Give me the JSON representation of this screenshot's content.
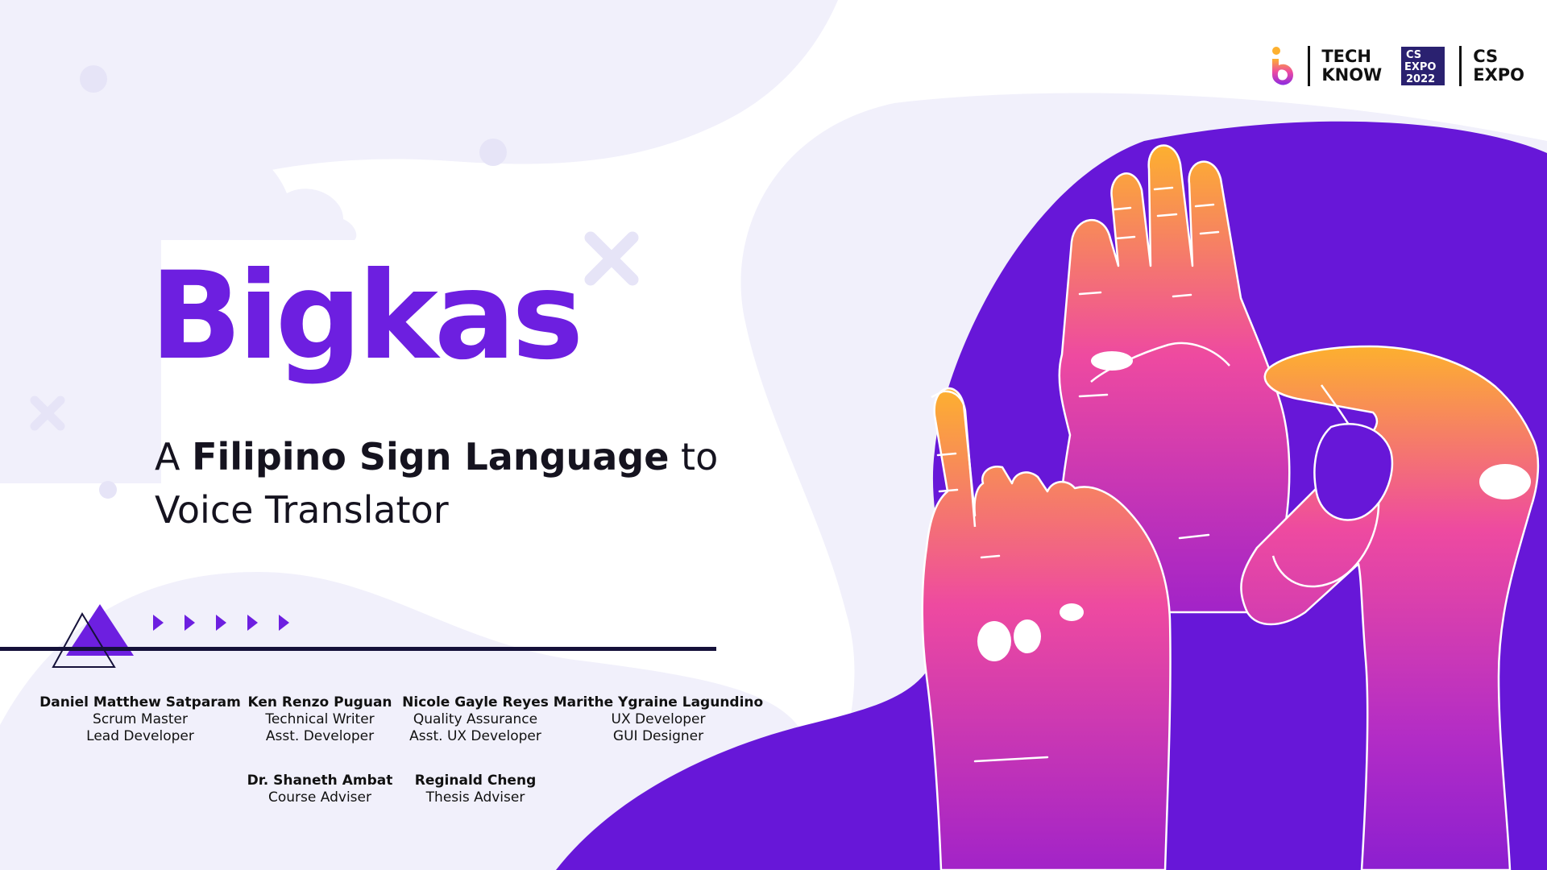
{
  "title": "Bigkas",
  "subtitle": {
    "prefix": "A ",
    "highlight": "Filipino Sign Language",
    "suffix": " to",
    "line2": "Voice Translator"
  },
  "logos": {
    "techknow_line1": "TECH",
    "techknow_line2": "KNOW",
    "expo_badge_line1": "CS",
    "expo_badge_line2": "EXPO",
    "expo_badge_line3": "2022",
    "csexpo_line1": "CS",
    "csexpo_line2": "EXPO"
  },
  "team": [
    {
      "name": "Daniel Matthew Satparam",
      "roles": [
        "Scrum Master",
        "Lead Developer"
      ]
    },
    {
      "name": "Ken Renzo Puguan",
      "roles": [
        "Technical Writer",
        "Asst. Developer"
      ]
    },
    {
      "name": "Nicole Gayle Reyes",
      "roles": [
        "Quality Assurance",
        "Asst. UX Developer"
      ]
    },
    {
      "name": "Marithe Ygraine Lagundino",
      "roles": [
        "UX Developer",
        "GUI Designer"
      ]
    },
    {
      "name": "Dr. Shaneth Ambat",
      "roles": [
        "Course Adviser"
      ]
    },
    {
      "name": "Reginald Cheng",
      "roles": [
        "Thesis Adviser"
      ]
    }
  ],
  "colors": {
    "brand_purple": "#6d1fe0",
    "deep_purple": "#6717d8",
    "lavender": "#f1f0fb",
    "hand_top": "#fdb02f",
    "hand_mid": "#ee4aa0",
    "hand_bottom": "#a223c8",
    "line_navy": "#15113a"
  }
}
